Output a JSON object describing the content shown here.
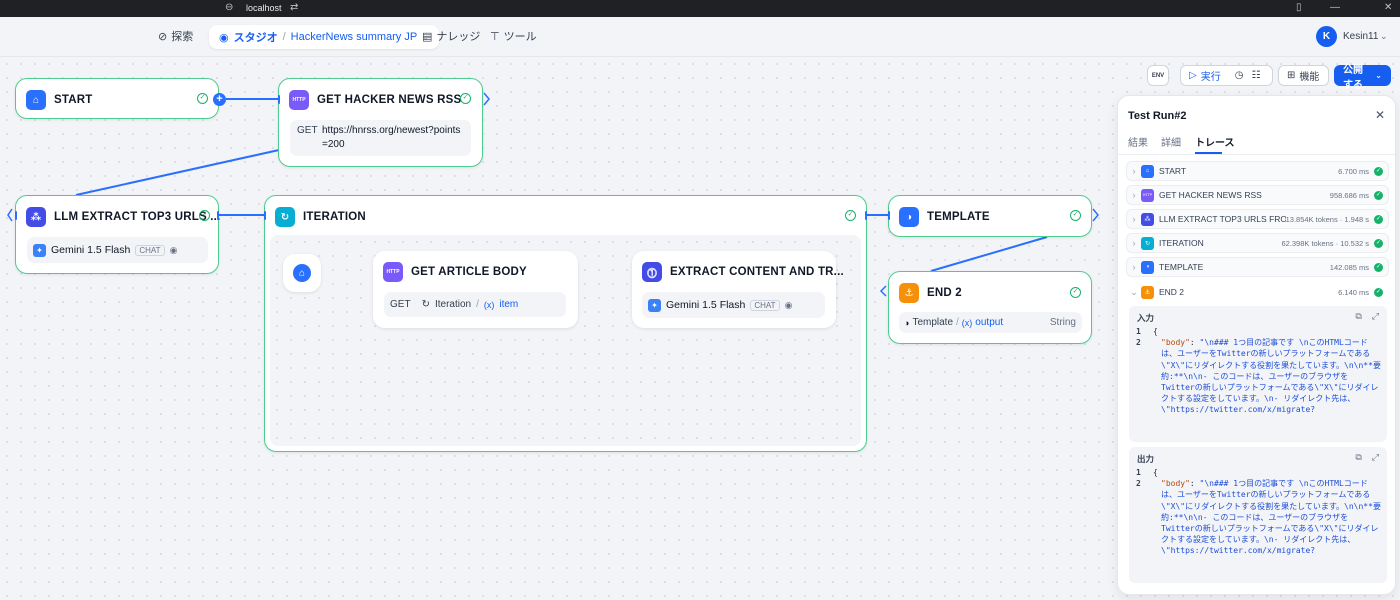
{
  "browser": {
    "url": "localhost"
  },
  "nav": {
    "explore": "探索",
    "studio": "スタジオ",
    "app_name": "HackerNews summary JP",
    "knowledge": "ナレッジ",
    "tools": "ツール",
    "avatar_initial": "K",
    "user": "Kesin11"
  },
  "toolbar": {
    "env_label": "ENV",
    "run": "実行",
    "features": "機能",
    "publish": "公開する"
  },
  "nodes": {
    "start": {
      "title": "START"
    },
    "get_rss": {
      "title": "GET HACKER NEWS RSS",
      "icon_text": "HTTP",
      "method": "GET",
      "url_line1": "https://hnrss.org/newest?points",
      "url_line2": "=200"
    },
    "llm": {
      "title": "LLM EXTRACT TOP3 URLS ...",
      "model": "Gemini 1.5 Flash",
      "mode": "CHAT"
    },
    "iteration": {
      "title": "ITERATION"
    },
    "article": {
      "title": "GET ARTICLE BODY",
      "icon_text": "HTTP",
      "method": "GET",
      "var_node": "Iteration",
      "var_sep": "/",
      "var_name": "item"
    },
    "extract": {
      "title": "EXTRACT CONTENT AND TR...",
      "model": "Gemini 1.5 Flash",
      "mode": "CHAT"
    },
    "template": {
      "title": "TEMPLATE"
    },
    "end": {
      "title": "END 2",
      "var_node": "Template",
      "var_sep": "/",
      "var_name": "output",
      "var_type": "String"
    }
  },
  "panel": {
    "title": "Test Run#2",
    "tabs": [
      "結果",
      "詳細",
      "トレース"
    ],
    "active_tab": "トレース",
    "trace": [
      {
        "name": "START",
        "meta": "6.700 ms",
        "icon": "home-icon",
        "color": "#2970ff"
      },
      {
        "name": "GET HACKER NEWS RSS",
        "meta": "958.686 ms",
        "icon": "http-icon",
        "color": "#7a5af8"
      },
      {
        "name": "LLM EXTRACT TOP3 URLS FROM...",
        "meta": "13.854K tokens · 1.948 s",
        "icon": "llm-icon",
        "color": "#444ce7"
      },
      {
        "name": "ITERATION",
        "meta": "62.398K tokens · 10.532 s",
        "icon": "iteration-icon",
        "color": "#06aed4"
      },
      {
        "name": "TEMPLATE",
        "meta": "142.085 ms",
        "icon": "template-icon",
        "color": "#2970ff"
      },
      {
        "name": "END 2",
        "meta": "6.140 ms",
        "icon": "end-icon",
        "color": "#f79009"
      }
    ],
    "input_label": "入力",
    "output_label": "出力",
    "code_line1": "{",
    "code_key": "\"body\"",
    "code_colon": ": ",
    "code_value": "\"\\n### 1つ目の記事です \\nこのHTMLコードは、ユーザーをTwitterの新しいプラットフォームである\\\"X\\\"にリダイレクトする役割を果たしています。\\n\\n**要約:**\\n\\n- このコードは、ユーザーのブラウザをTwitterの新しいプラットフォームである\\\"X\\\"にリダイレクトする設定をしています。\\n- リダイレクト先は、\\\"https://twitter.com/x/migrate?"
  },
  "colors": {
    "accent": "#155eef",
    "success": "#17b26a",
    "node_border": "#4ecc8f",
    "edge": "#2970ff"
  }
}
